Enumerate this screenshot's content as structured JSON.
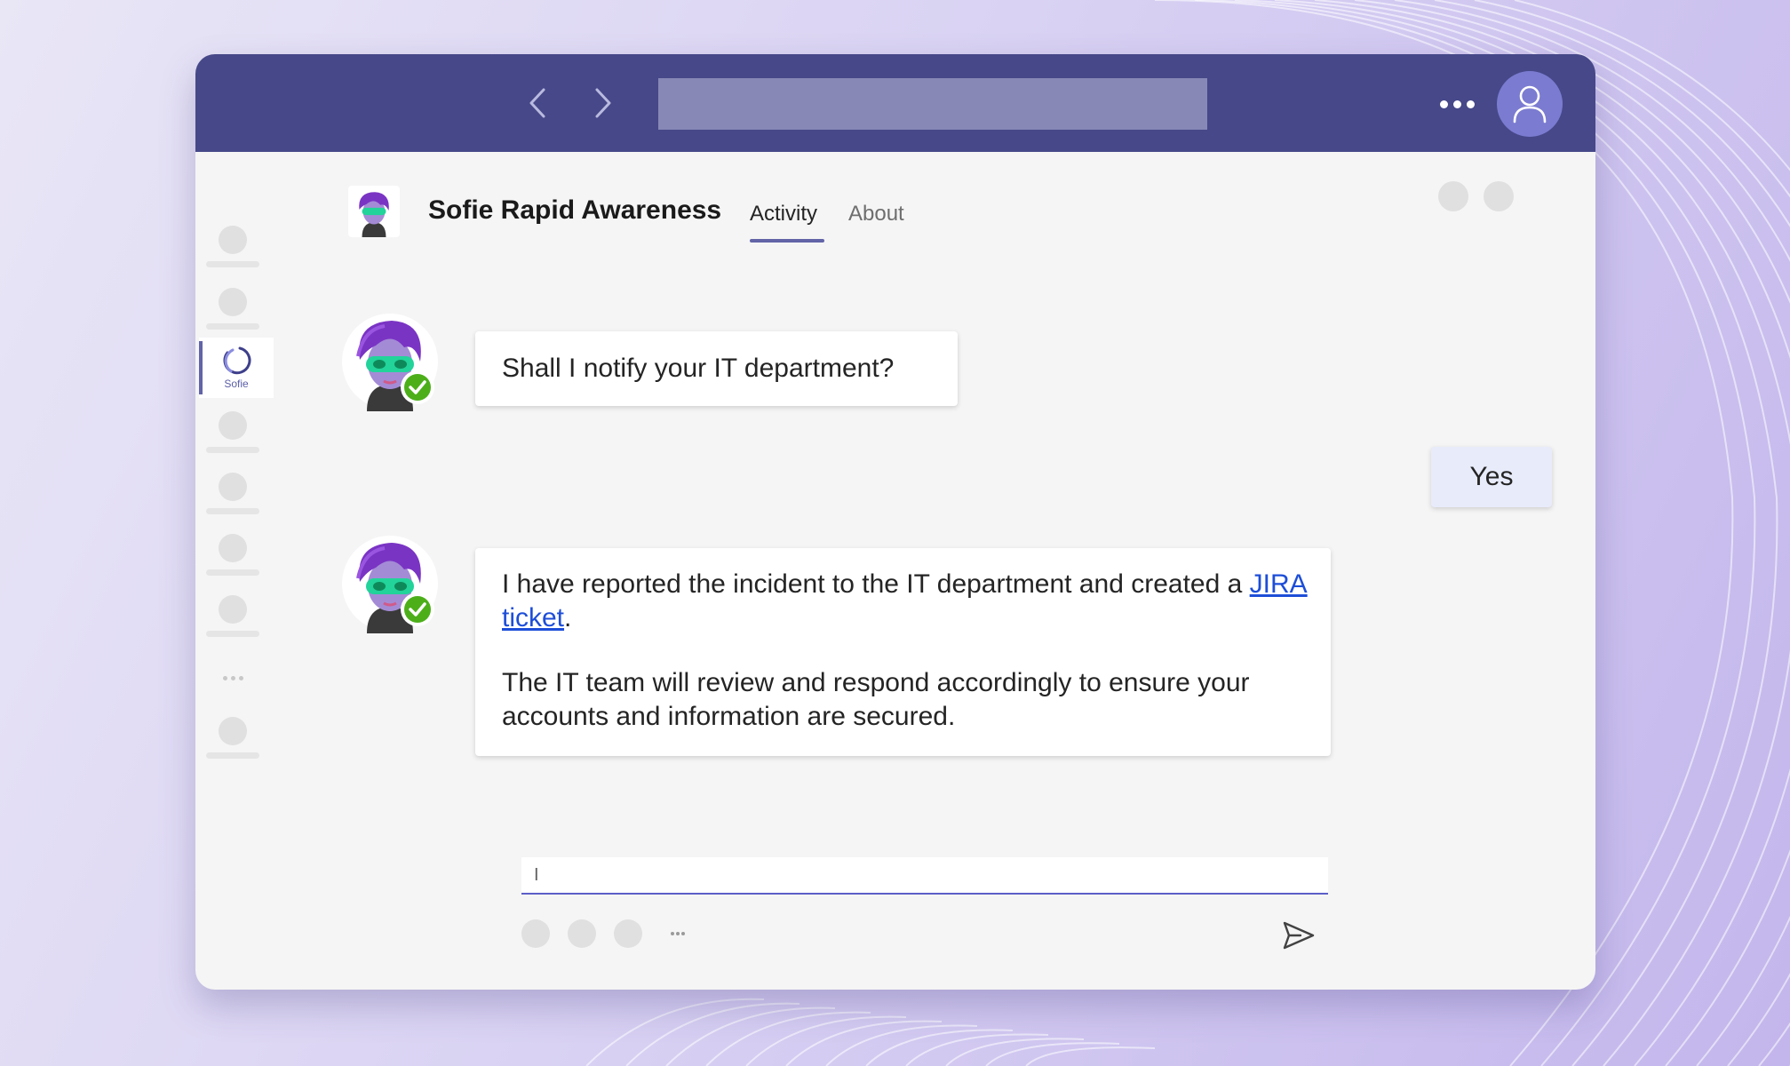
{
  "colors": {
    "topbar": "#464889",
    "address_bar": "#8788b6",
    "profile": "#7b7bd1",
    "accent": "#6264a7",
    "link": "#1d4ed8",
    "user_bubble": "#e8ebfa",
    "presence": "#4caf1a"
  },
  "topbar": {
    "back_icon": "chevron-left-icon",
    "forward_icon": "chevron-right-icon",
    "address_value": "",
    "more_icon": "more-horizontal-icon",
    "profile_icon": "person-icon"
  },
  "rail": {
    "active_label": "Sofie",
    "active_icon": "sofie-logo-icon",
    "more_icon": "more-horizontal-icon"
  },
  "header": {
    "app_name": "Sofie Rapid Awareness",
    "tabs": [
      {
        "label": "Activity",
        "active": true
      },
      {
        "label": "About",
        "active": false
      }
    ]
  },
  "messages": [
    {
      "sender": "bot",
      "text": "Shall I notify your IT department?"
    },
    {
      "sender": "user",
      "text": "Yes"
    },
    {
      "sender": "bot",
      "text_before_link": "I have reported the incident to the IT department and created a ",
      "link_text": "JIRA ticket",
      "text_after_link": ".",
      "paragraph2": "The IT team will review and respond accordingly to ensure your accounts and information are secured."
    }
  ],
  "compose": {
    "value": "I",
    "more_icon": "more-horizontal-icon",
    "send_icon": "send-icon"
  }
}
